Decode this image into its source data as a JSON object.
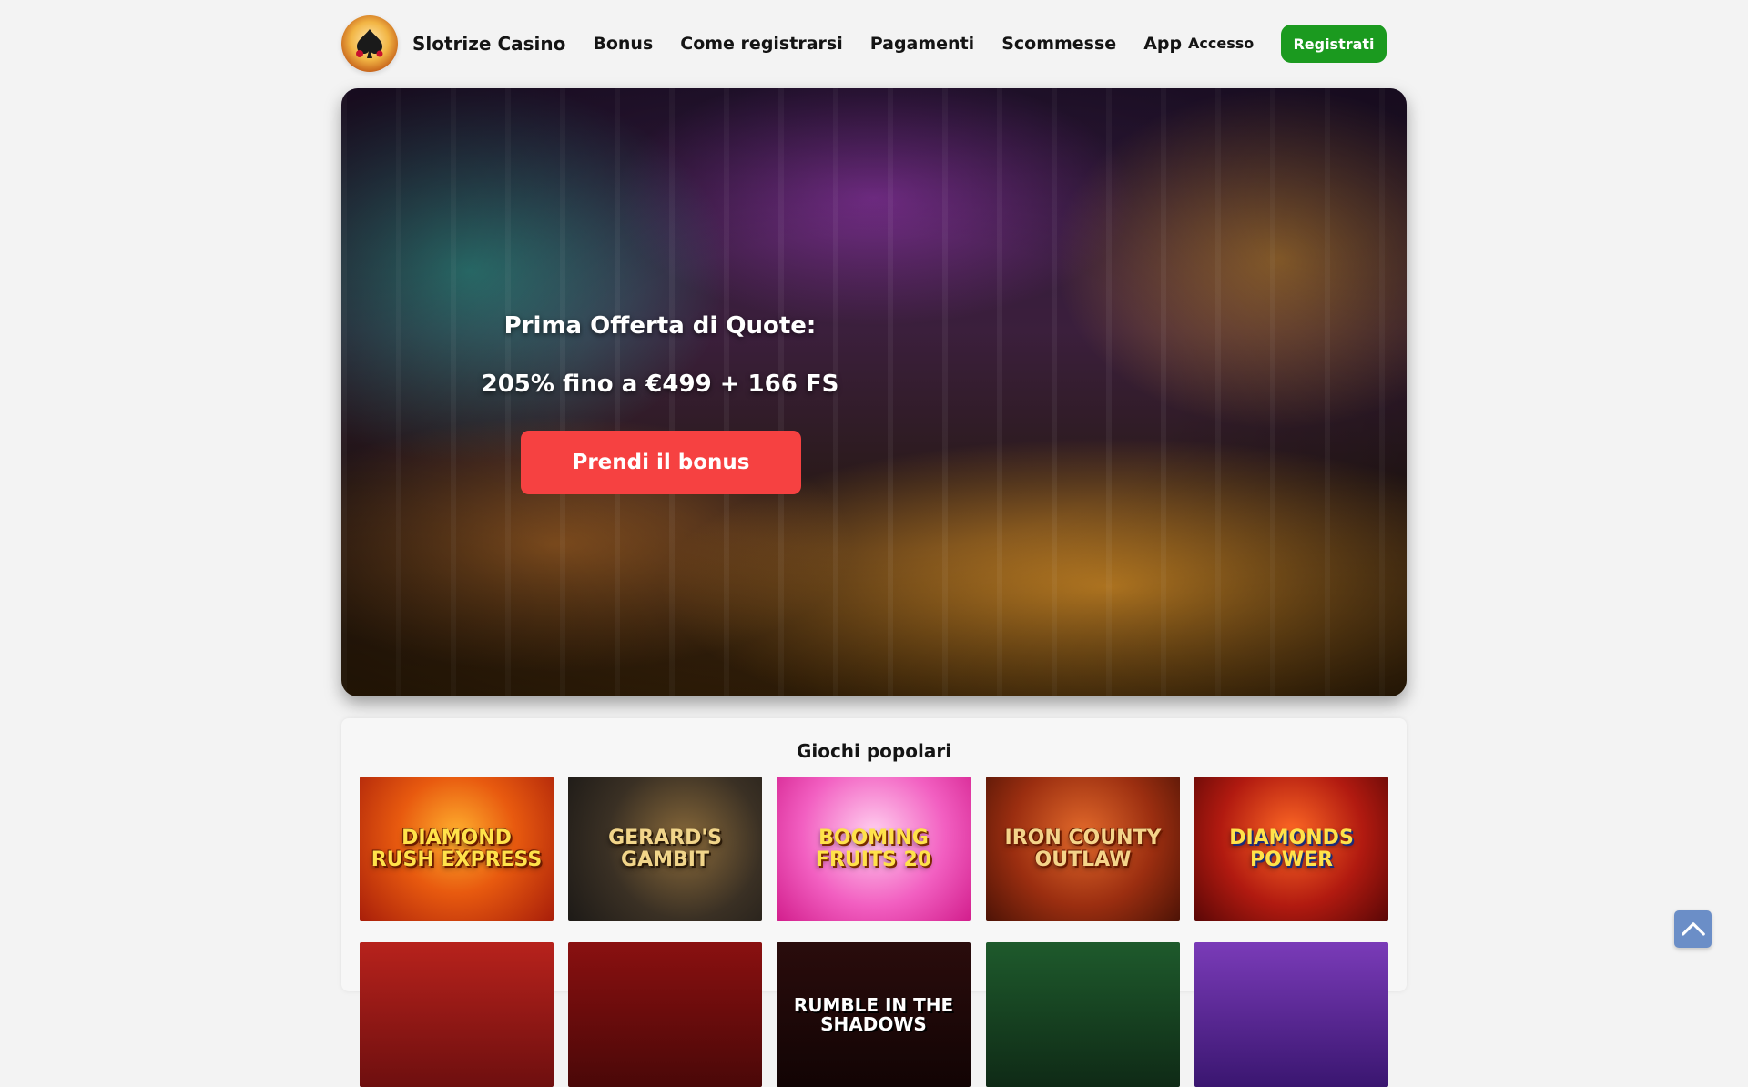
{
  "header": {
    "logo_icon": "spade-casino-logo-icon",
    "brand": "Slotrize Casino",
    "nav": [
      "Bonus",
      "Come registrarsi",
      "Pagamenti",
      "Scommesse",
      "App"
    ],
    "login_label": "Accesso",
    "signup_label": "Registrati",
    "signup_color": "#1b9a1f"
  },
  "hero": {
    "title": "Prima Offerta di Quote:",
    "subtitle": "205% fino a €499 + 166 FS",
    "cta_label": "Prendi il bonus",
    "cta_color": "#f64141"
  },
  "games": {
    "title": "Giochi popolari",
    "items": [
      {
        "name": "DIAMOND RUSH EXPRESS"
      },
      {
        "name": "GERARD'S GAMBIT"
      },
      {
        "name": "BOOMING FRUITS 20"
      },
      {
        "name": "IRON COUNTY OUTLAW"
      },
      {
        "name": "DIAMONDS POWER"
      },
      {
        "name": ""
      },
      {
        "name": ""
      },
      {
        "name": "RUMBLE IN THE SHADOWS"
      },
      {
        "name": ""
      },
      {
        "name": ""
      }
    ]
  },
  "scroll_top_icon": "chevron-up-icon"
}
